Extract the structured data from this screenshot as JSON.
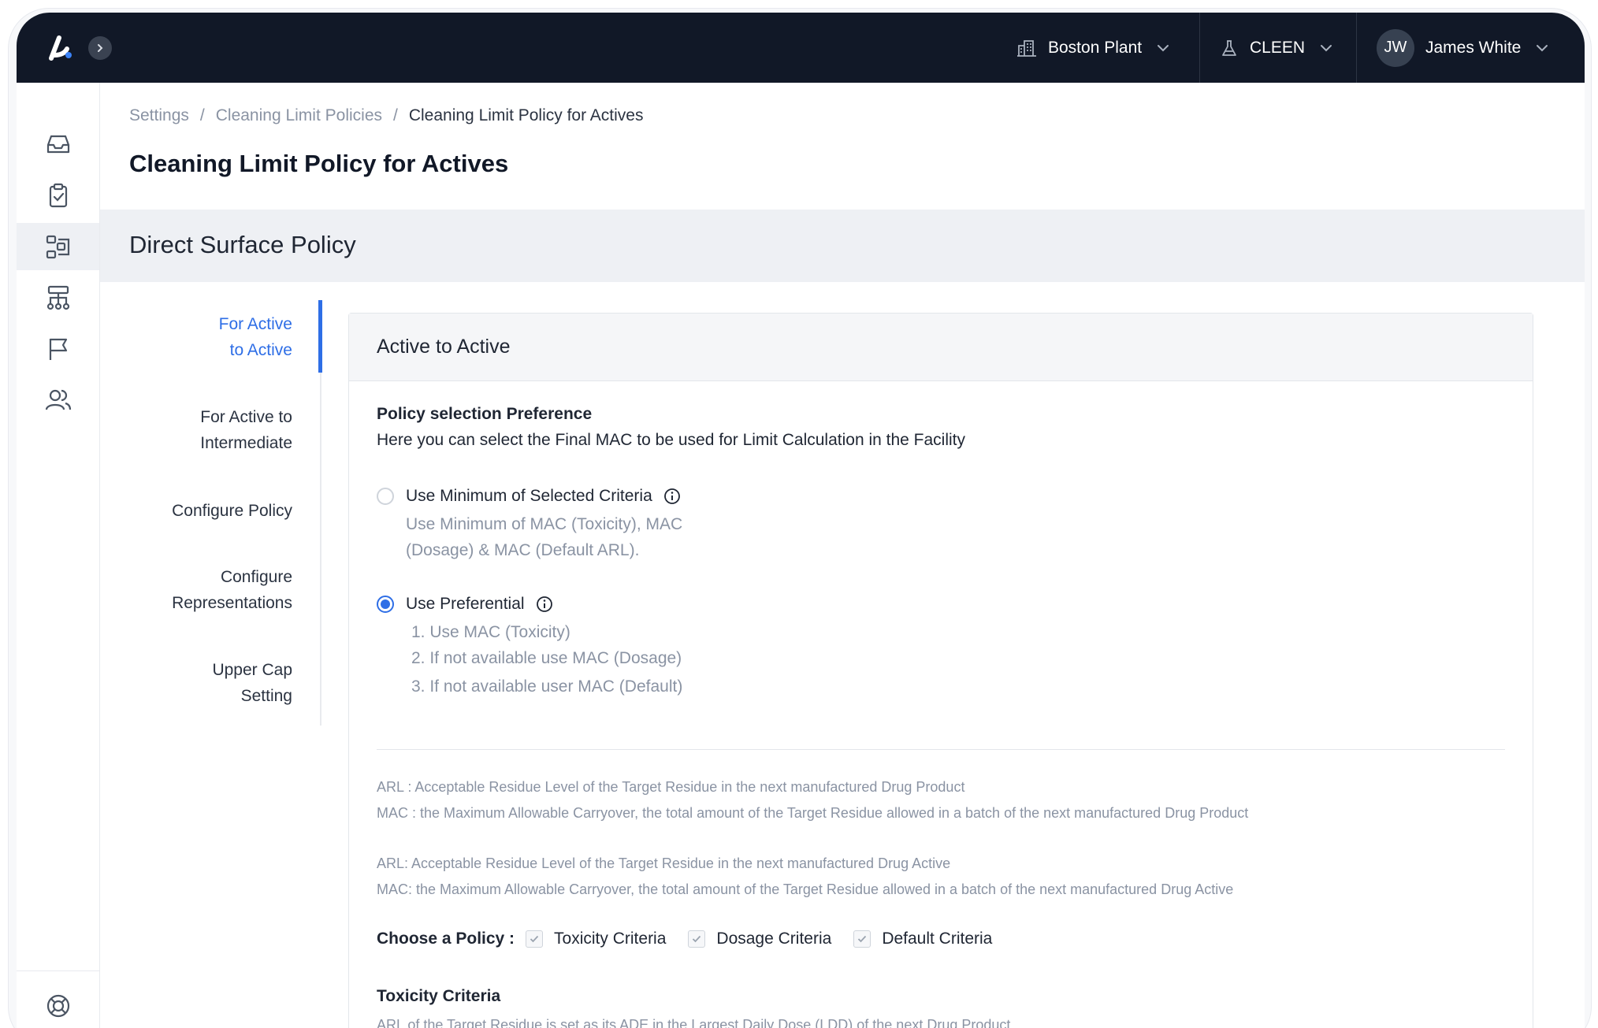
{
  "topbar": {
    "plant": "Boston Plant",
    "module": "CLEEN",
    "user_initials": "JW",
    "user_name": "James White"
  },
  "sidebar": {
    "items": [
      "inbox-icon",
      "clipboard-check-icon",
      "policy-flow-icon",
      "hierarchy-icon",
      "flag-icon",
      "users-icon"
    ],
    "active_index": 2,
    "bottom": "help-lifebuoy-icon"
  },
  "breadcrumb": {
    "items": [
      "Settings",
      "Cleaning Limit Policies",
      "Cleaning Limit Policy for Actives"
    ],
    "separator": "/"
  },
  "page": {
    "title": "Cleaning Limit Policy for Actives",
    "section_title": "Direct Surface Policy"
  },
  "subnav": {
    "items": [
      "For Active\nto Active",
      "For Active to\nIntermediate",
      "Configure Policy",
      "Configure\nRepresentations",
      "Upper Cap\nSetting"
    ],
    "active_index": 0
  },
  "card": {
    "title": "Active to Active",
    "pref_heading": "Policy selection Preference",
    "pref_desc": "Here you can select the Final MAC to be used for Limit Calculation  in the Facility",
    "option_min": {
      "label": "Use Minimum of Selected Criteria",
      "desc_line1": "Use Minimum of MAC (Toxicity), MAC",
      "desc_line2": "(Dosage) & MAC (Default ARL).",
      "selected": false
    },
    "option_pref": {
      "label": "Use Preferential",
      "steps": [
        "1. Use MAC (Toxicity)",
        "2. If not available use MAC (Dosage)",
        "3. If not available user MAC (Default)"
      ],
      "selected": true
    },
    "notes": [
      "ARL :  Acceptable Residue Level of the Target Residue in the next manufactured Drug Product",
      "MAC : the Maximum Allowable Carryover, the total amount of the Target Residue allowed in a batch of the next manufactured Drug Product",
      "ARL: Acceptable Residue Level of the Target Residue in the next manufactured Drug Active",
      "MAC: the Maximum Allowable Carryover, the total amount of the Target Residue allowed in a batch of the next manufactured Drug Active"
    ],
    "choose_label": "Choose a Policy :",
    "criteria": [
      "Toxicity Criteria",
      "Dosage Criteria",
      "Default Criteria"
    ],
    "tox_heading": "Toxicity Criteria",
    "tox_desc": "ARL of the Target Residue is set as its ADE in the Largest Daily Dose (LDD) of the next Drug Product"
  },
  "colors": {
    "topbar": "#111827",
    "accent": "#2e6ee6",
    "band": "#eef0f4"
  }
}
